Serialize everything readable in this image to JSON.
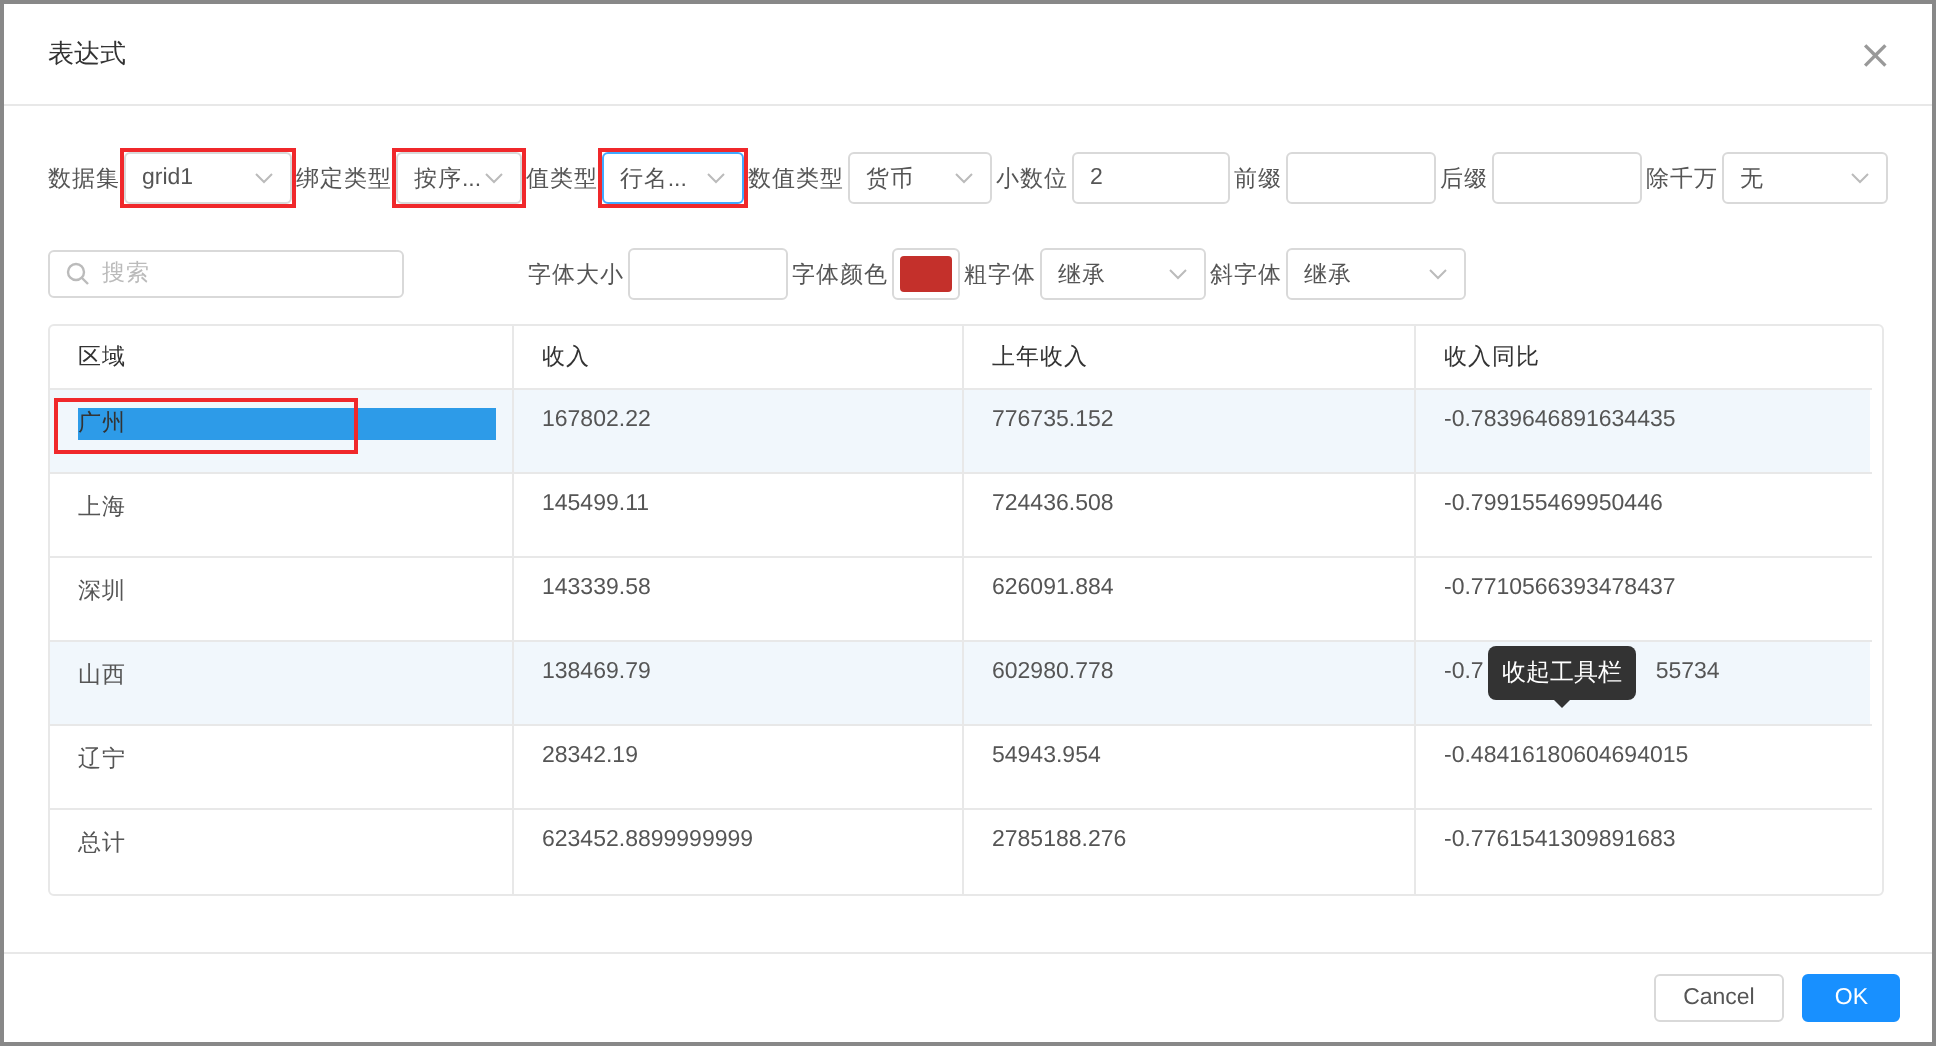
{
  "dialog": {
    "title": "表达式",
    "close": "×"
  },
  "row1": [
    {
      "kind": "select",
      "label": "数据集",
      "value": "grid1",
      "highlighted": true,
      "focused": false
    },
    {
      "kind": "select",
      "label": "绑定类型",
      "value": "按序...",
      "highlighted": true,
      "focused": false
    },
    {
      "kind": "select",
      "label": "值类型",
      "value": "行名...",
      "highlighted": true,
      "focused": true
    },
    {
      "kind": "select",
      "label": "数值类型",
      "value": "货币",
      "highlighted": false,
      "focused": false
    },
    {
      "kind": "input",
      "label": "小数位",
      "value": "2"
    },
    {
      "kind": "input",
      "label": "前缀"
    },
    {
      "kind": "input",
      "label": "后缀"
    },
    {
      "kind": "select",
      "label": "除千万",
      "value": "无",
      "highlighted": false,
      "focused": false
    }
  ],
  "search": {
    "placeholder": "搜索"
  },
  "row2": [
    {
      "kind": "input",
      "label": "字体大小"
    },
    {
      "kind": "color",
      "label": "字体颜色",
      "color": "#c4302b"
    },
    {
      "kind": "select",
      "label": "粗字体",
      "value": "继承",
      "highlighted": false,
      "focused": false
    },
    {
      "kind": "select",
      "label": "斜字体",
      "value": "继承",
      "highlighted": false,
      "focused": false
    }
  ],
  "table": {
    "columns": [
      "区域",
      "收入",
      "上年收入",
      "收入同比"
    ],
    "rows": [
      {
        "shaded": true,
        "cells": [
          {
            "text": "广州",
            "text_selected": true,
            "highlighted": true
          },
          {
            "text": "167802.22"
          },
          {
            "text": "776735.152"
          },
          {
            "text": "-0.7839646891634435"
          }
        ]
      },
      {
        "shaded": false,
        "cells": [
          {
            "text": "上海"
          },
          {
            "text": "145499.11"
          },
          {
            "text": "724436.508"
          },
          {
            "text": "-0.799155469950446"
          }
        ]
      },
      {
        "shaded": false,
        "cells": [
          {
            "text": "深圳"
          },
          {
            "text": "143339.58"
          },
          {
            "text": "626091.884"
          },
          {
            "text": "-0.7710566393478437"
          }
        ]
      },
      {
        "shaded": true,
        "cells": [
          {
            "text": "山西"
          },
          {
            "text": "138469.79"
          },
          {
            "text": "602980.778"
          },
          {
            "text": "-0.7",
            "text_after_tooltip": "55734",
            "tooltip": "收起工具栏"
          }
        ]
      },
      {
        "shaded": false,
        "cells": [
          {
            "text": "辽宁"
          },
          {
            "text": "28342.19"
          },
          {
            "text": "54943.954"
          },
          {
            "text": "-0.48416180604694015"
          }
        ]
      },
      {
        "shaded": false,
        "cells": [
          {
            "text": "总计"
          },
          {
            "text": "623452.8899999999"
          },
          {
            "text": "2785188.276"
          },
          {
            "text": "-0.7761541309891683"
          }
        ]
      }
    ]
  },
  "buttons": [
    {
      "label": "Cancel",
      "primary": false
    },
    {
      "label": "OK",
      "primary": true
    }
  ]
}
